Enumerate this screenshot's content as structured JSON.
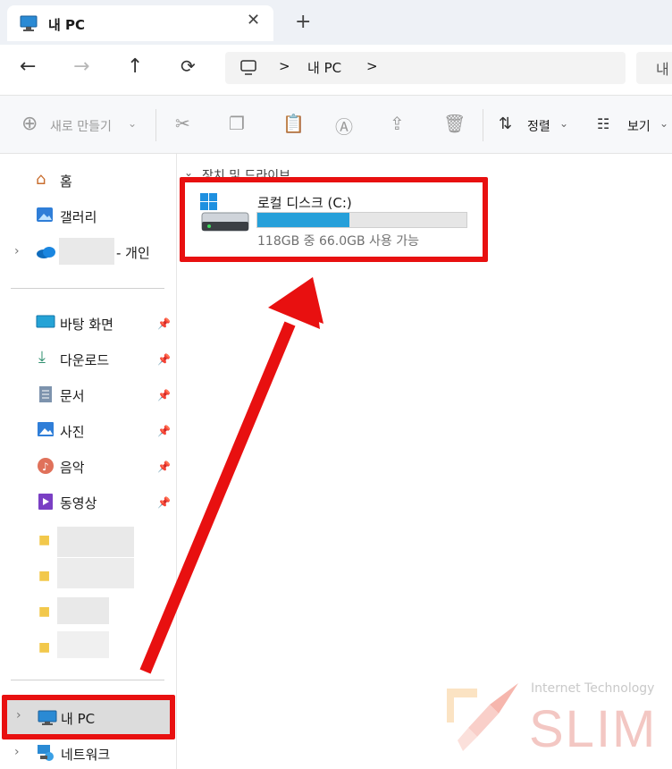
{
  "window": {
    "tab_title": "내 PC",
    "tab_close": "✕",
    "new_tab": "+"
  },
  "nav": {
    "back": "←",
    "forward": "→",
    "up": "↑",
    "refresh": "⟳",
    "breadcrumb_sep1": ">",
    "breadcrumb_item": "내 PC",
    "breadcrumb_sep2": ">",
    "search_partial": "내"
  },
  "commands": {
    "new_label": "새로 만들기",
    "sort_label": "정렬",
    "view_label": "보기"
  },
  "sidebar": {
    "home": "홈",
    "gallery": "갤러리",
    "onedrive_suffix": "- 개인",
    "quick": [
      {
        "label": "바탕 화면",
        "icon": "desktop-icon"
      },
      {
        "label": "다운로드",
        "icon": "download-icon"
      },
      {
        "label": "문서",
        "icon": "document-icon"
      },
      {
        "label": "사진",
        "icon": "pictures-icon"
      },
      {
        "label": "음악",
        "icon": "music-icon"
      },
      {
        "label": "동영상",
        "icon": "video-icon"
      }
    ],
    "this_pc": "내 PC",
    "network": "네트워크"
  },
  "main": {
    "section_title": "장치 및 드라이브",
    "drive_name": "로컬 디스크 (C:)",
    "drive_info": "118GB 중 66.0GB 사용 가능",
    "drive_used_fraction": 0.44
  },
  "watermark": {
    "line1": "Internet Technology",
    "line2": "SLIM"
  },
  "colors": {
    "annotation_red": "#e81010",
    "drive_bar": "#26a0da"
  }
}
